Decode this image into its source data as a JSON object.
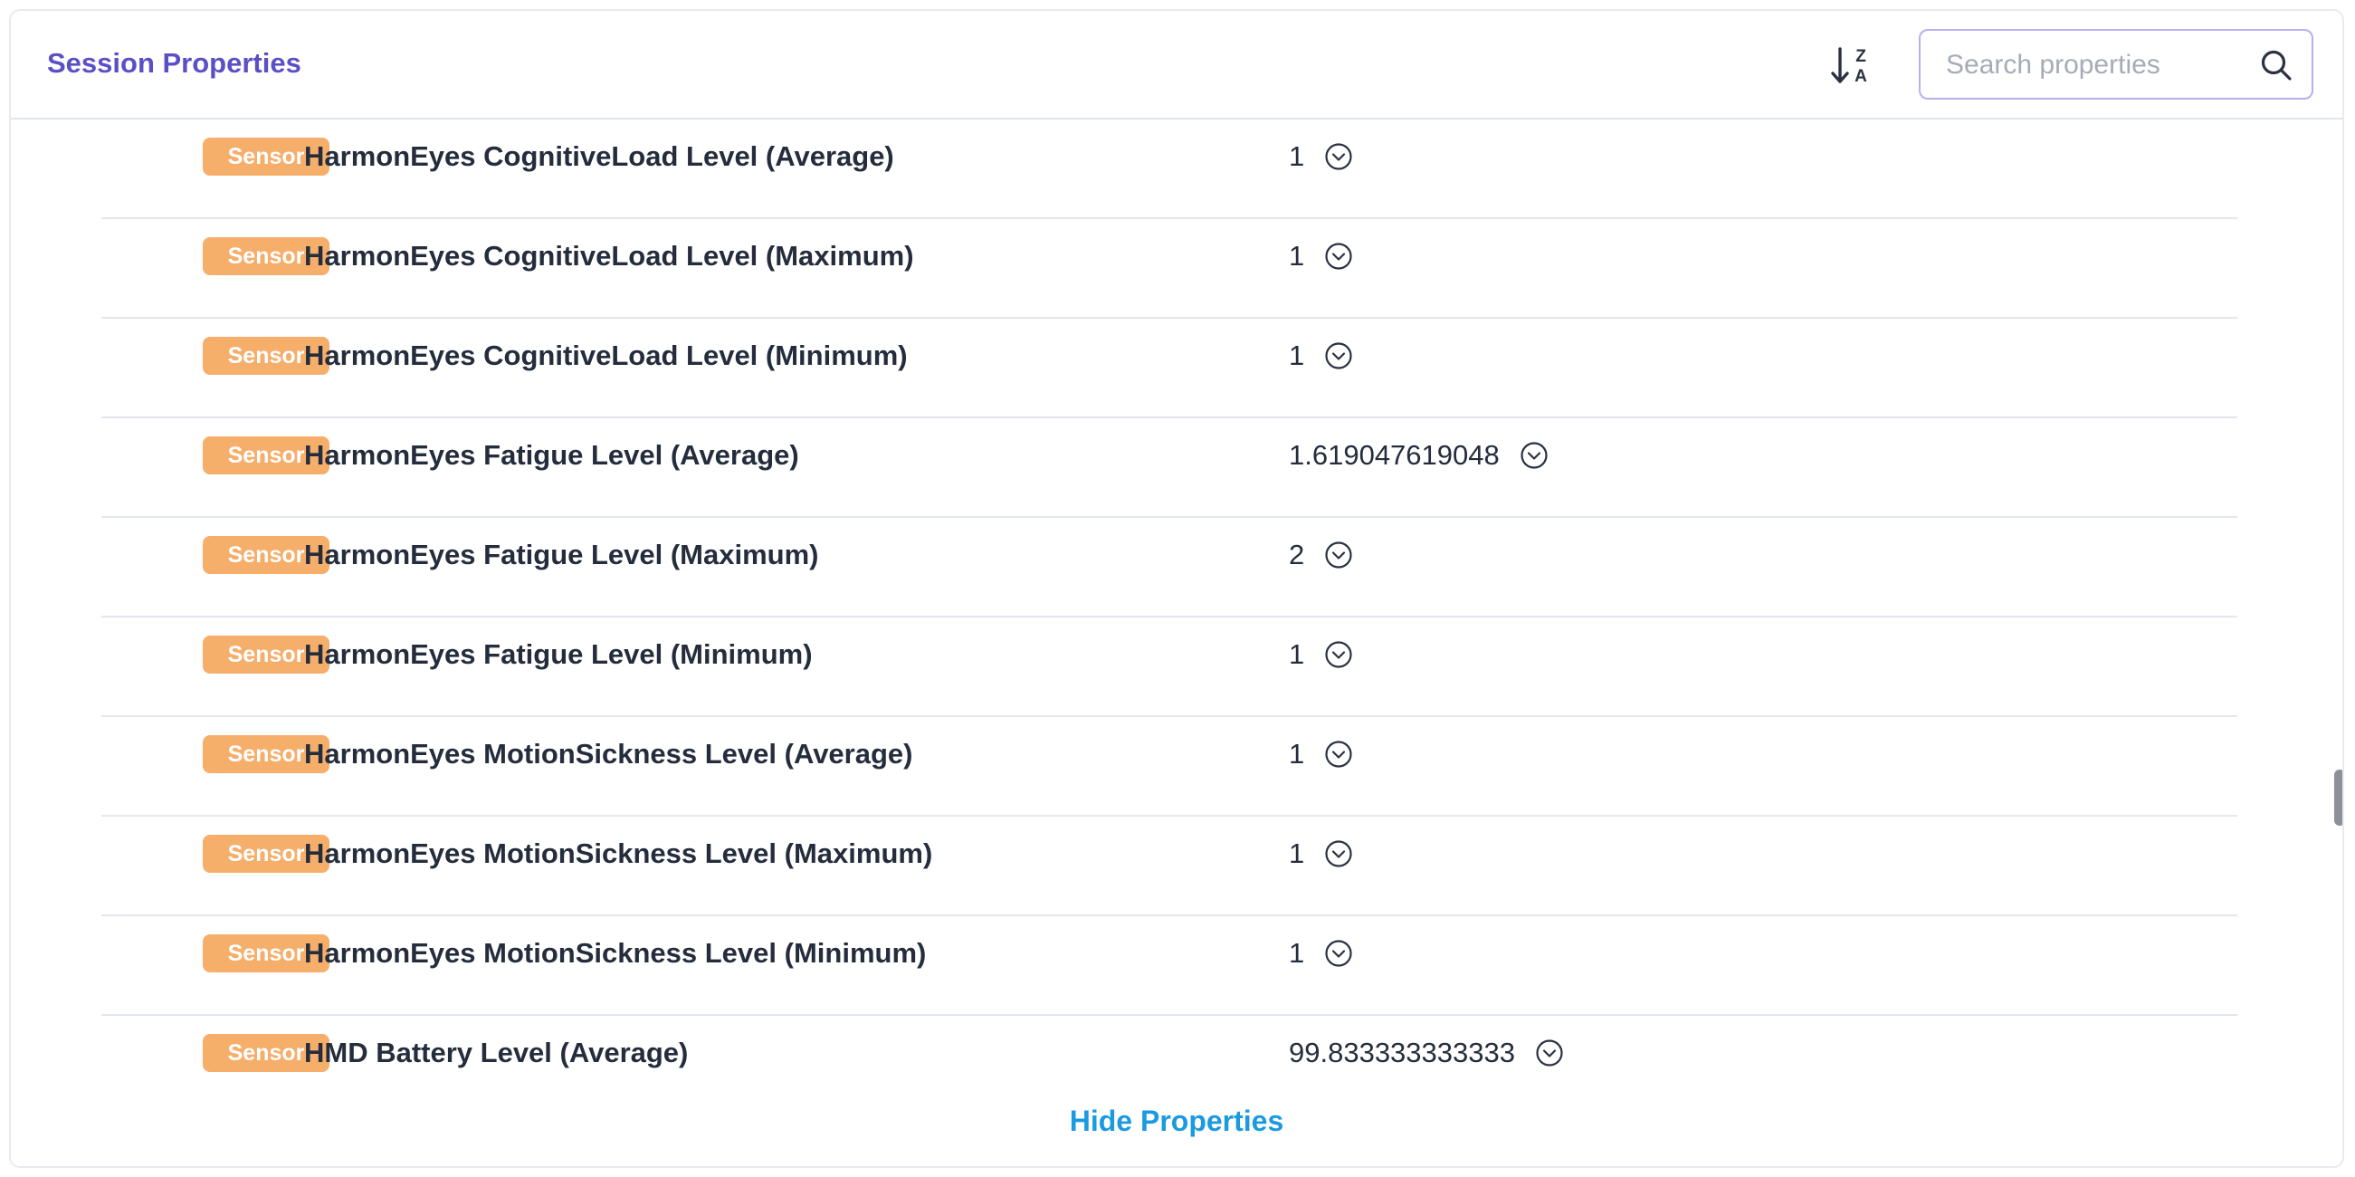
{
  "header": {
    "title": "Session Properties",
    "sort_icon": "sort-z-a-icon",
    "search_placeholder": "Search properties",
    "search_icon": "search-icon"
  },
  "rows": [
    {
      "tag": "Sensor",
      "name": "HarmonEyes CognitiveLoad Level (Average)",
      "value": "1"
    },
    {
      "tag": "Sensor",
      "name": "HarmonEyes CognitiveLoad Level (Maximum)",
      "value": "1"
    },
    {
      "tag": "Sensor",
      "name": "HarmonEyes CognitiveLoad Level (Minimum)",
      "value": "1"
    },
    {
      "tag": "Sensor",
      "name": "HarmonEyes Fatigue Level (Average)",
      "value": "1.619047619048"
    },
    {
      "tag": "Sensor",
      "name": "HarmonEyes Fatigue Level (Maximum)",
      "value": "2"
    },
    {
      "tag": "Sensor",
      "name": "HarmonEyes Fatigue Level (Minimum)",
      "value": "1"
    },
    {
      "tag": "Sensor",
      "name": "HarmonEyes MotionSickness Level (Average)",
      "value": "1"
    },
    {
      "tag": "Sensor",
      "name": "HarmonEyes MotionSickness Level (Maximum)",
      "value": "1"
    },
    {
      "tag": "Sensor",
      "name": "HarmonEyes MotionSickness Level (Minimum)",
      "value": "1"
    },
    {
      "tag": "Sensor",
      "name": "HMD Battery Level (Average)",
      "value": "99.833333333333"
    }
  ],
  "footer": {
    "hide_label": "Hide Properties"
  },
  "colors": {
    "accent": "#5b4fc7",
    "badge": "#f6ae6b",
    "link": "#1b9ae0",
    "text": "#252d3d"
  }
}
